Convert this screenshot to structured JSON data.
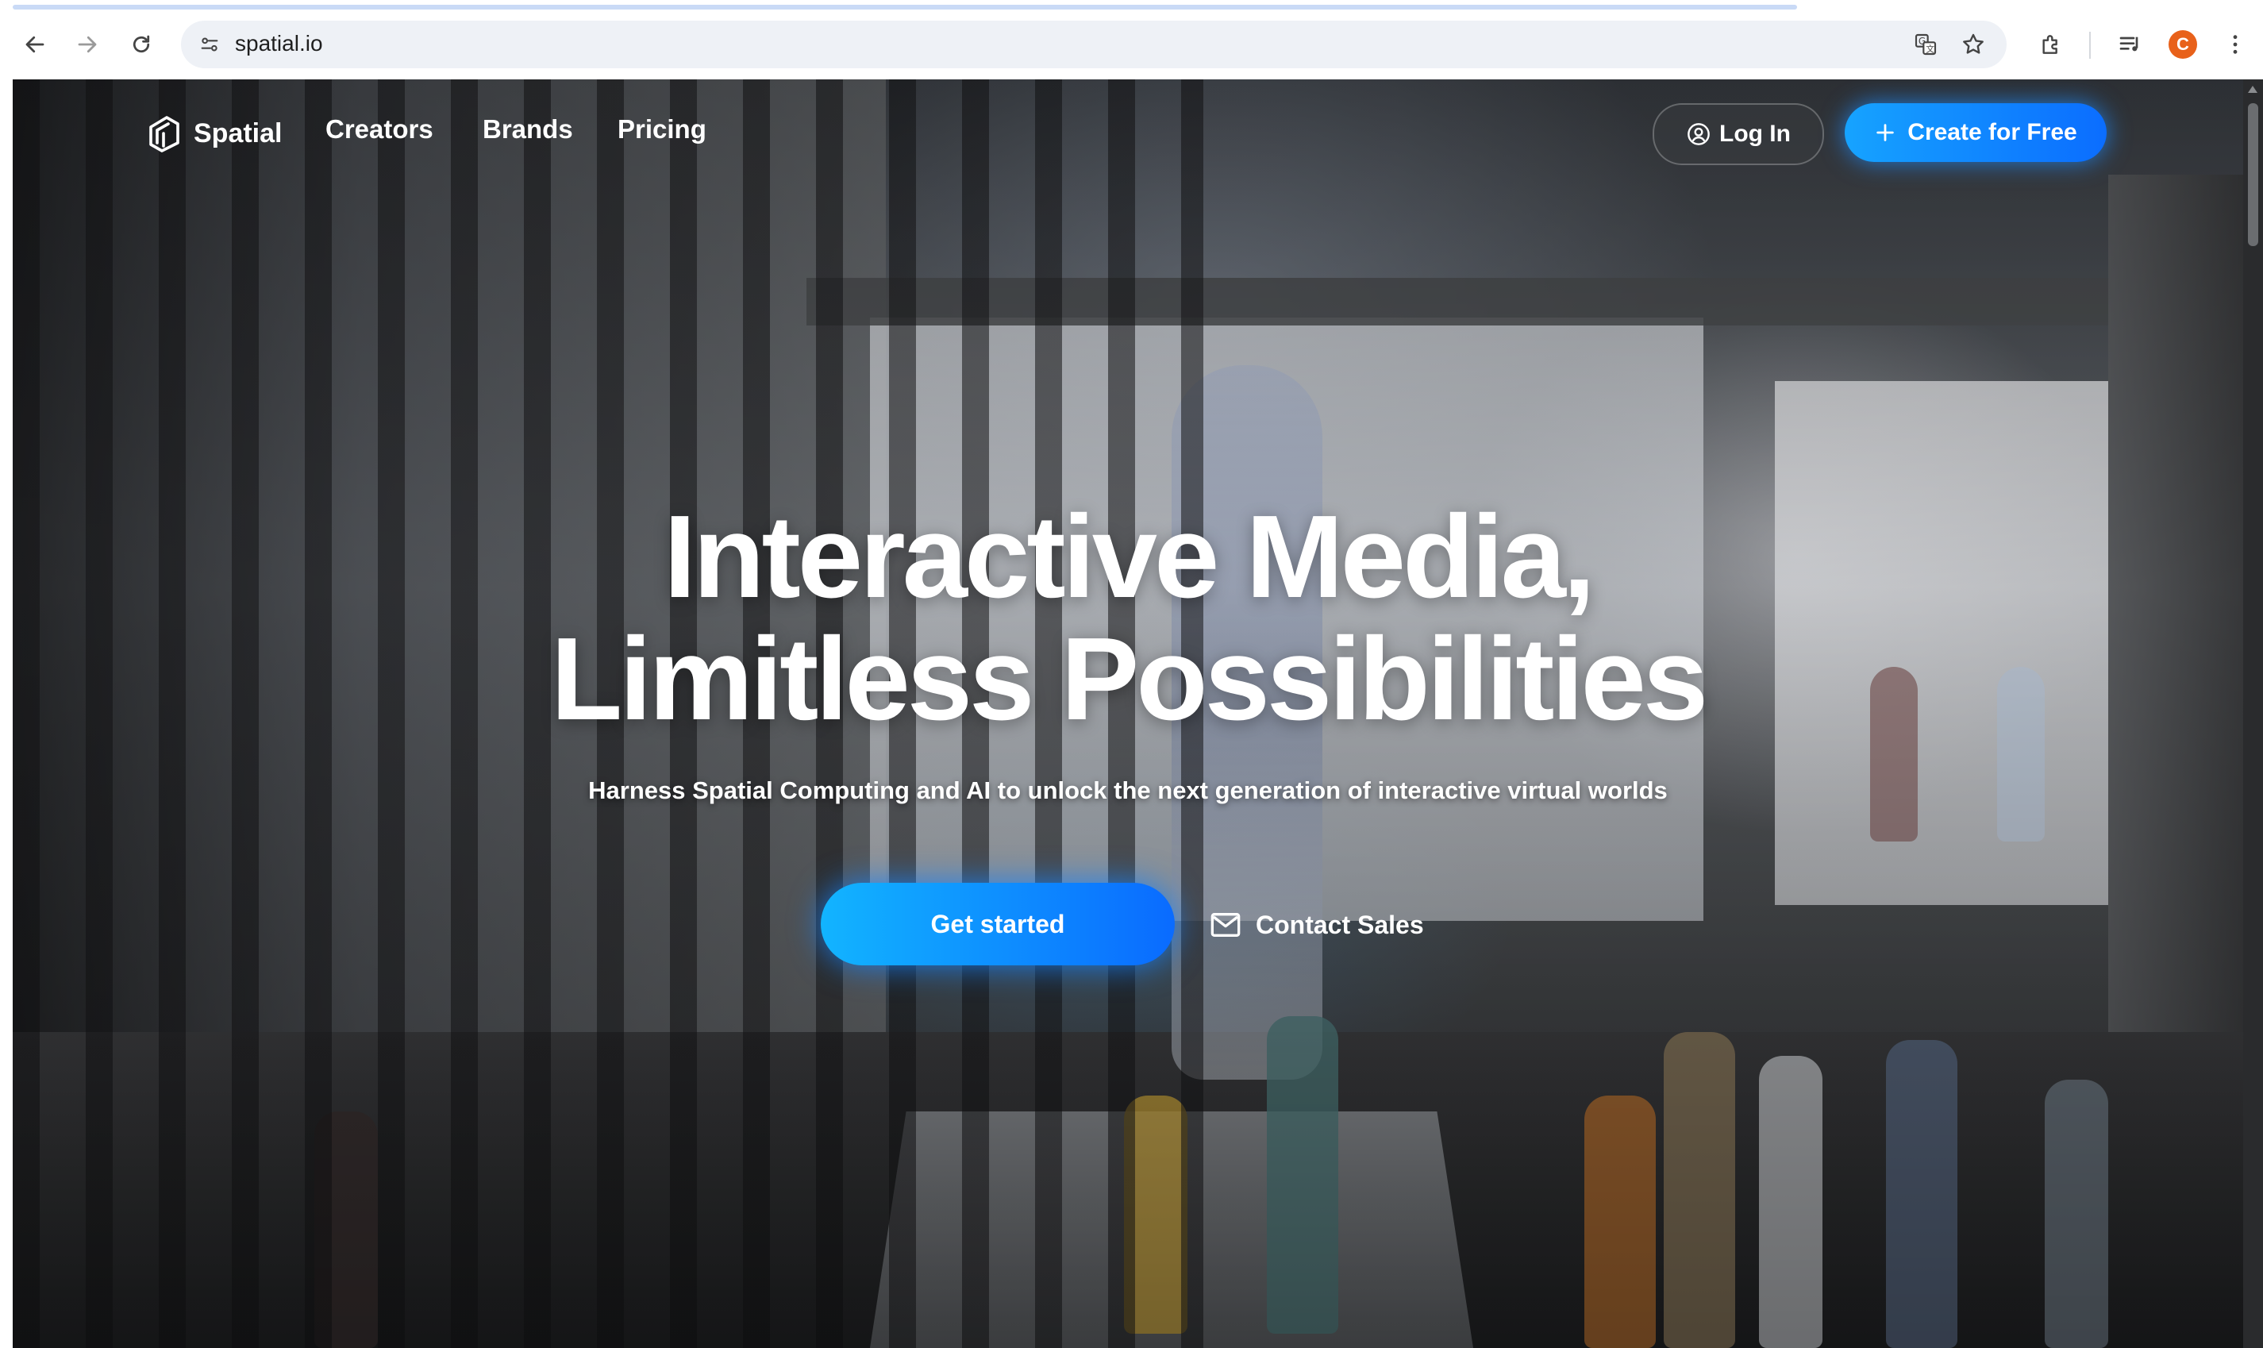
{
  "browser": {
    "url": "spatial.io",
    "profile_initial": "C"
  },
  "site": {
    "logo_text": "Spatial",
    "nav": [
      {
        "label": "Creators"
      },
      {
        "label": "Brands"
      },
      {
        "label": "Pricing"
      }
    ],
    "login_label": "Log In",
    "create_label": "Create for Free"
  },
  "hero": {
    "title_line1": "Interactive Media,",
    "title_line2": "Limitless Possibilities",
    "subtitle": "Harness Spatial Computing and AI to unlock the next generation of interactive virtual worlds",
    "primary_cta": "Get started",
    "secondary_cta": "Contact Sales"
  },
  "colors": {
    "accent": "#0b6dff",
    "accent_light": "#16a3ff",
    "profile": "#e8611a"
  },
  "icons": [
    "back-arrow-icon",
    "forward-arrow-icon",
    "reload-icon",
    "site-info-icon",
    "translate-icon",
    "star-icon",
    "extensions-icon",
    "media-queue-icon",
    "more-vert-icon",
    "spatial-logo-icon",
    "user-circle-icon",
    "plus-icon",
    "mail-icon"
  ]
}
